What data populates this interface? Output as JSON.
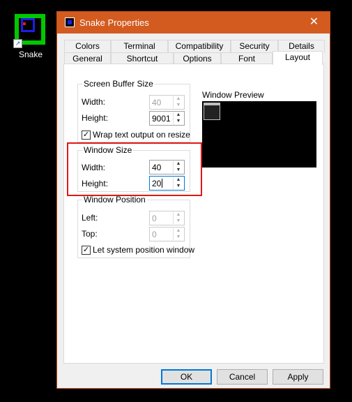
{
  "desktop": {
    "icon_label": "Snake"
  },
  "window": {
    "title": "Snake Properties",
    "close_glyph": "✕"
  },
  "tabs": {
    "row1": [
      "Colors",
      "Terminal",
      "Compatibility",
      "Security",
      "Details"
    ],
    "row2": [
      "General",
      "Shortcut",
      "Options",
      "Font",
      "Layout"
    ],
    "active": "Layout"
  },
  "screen_buffer": {
    "title": "Screen Buffer Size",
    "width_label": "Width:",
    "width_value": "40",
    "height_label": "Height:",
    "height_value": "9001",
    "wrap_label": "Wrap text output on resize",
    "wrap_checked": true
  },
  "window_size": {
    "title": "Window Size",
    "width_label": "Width:",
    "width_value": "40",
    "height_label": "Height:",
    "height_value": "20"
  },
  "window_position": {
    "title": "Window Position",
    "left_label": "Left:",
    "left_value": "0",
    "top_label": "Top:",
    "top_value": "0",
    "let_system_label": "Let system position window",
    "let_system_checked": true
  },
  "preview": {
    "label": "Window Preview"
  },
  "buttons": {
    "ok": "OK",
    "cancel": "Cancel",
    "apply": "Apply"
  },
  "glyphs": {
    "check": "✓",
    "up": "▲",
    "down": "▼",
    "shortcut": "↗"
  },
  "colors": {
    "titlebar": "#d35b20",
    "highlight": "#e01818",
    "icon_green": "#00c800",
    "focus": "#0078d7"
  }
}
